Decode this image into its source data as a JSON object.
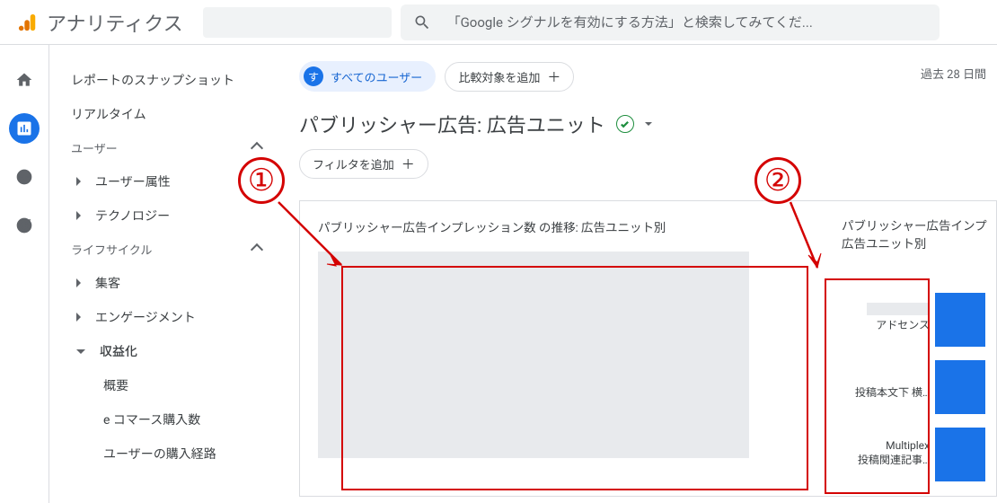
{
  "header": {
    "brand": "アナリティクス",
    "search_placeholder": "「Google シグナルを有効にする方法」と検索してみてくだ..."
  },
  "rail": {
    "icons": [
      "home",
      "reports",
      "explore",
      "advertising"
    ]
  },
  "sidebar": {
    "snapshot": "レポートのスナップショット",
    "realtime": "リアルタイム",
    "section_user": "ユーザー",
    "user_attr": "ユーザー属性",
    "technology": "テクノロジー",
    "section_lifecycle": "ライフサイクル",
    "acquisition": "集客",
    "engagement": "エンゲージメント",
    "monetization": "収益化",
    "overview": "概要",
    "ecommerce": "e コマース購入数",
    "purchase_path": "ユーザーの購入経路"
  },
  "main": {
    "segment_avatar": "す",
    "segment_label": "すべてのユーザー",
    "add_compare": "比較対象を追加",
    "date_range": "過去 28 日間",
    "title": "パブリッシャー広告: 広告ユニット",
    "add_filter": "フィルタを追加"
  },
  "card": {
    "left_title": "パブリッシャー広告インプレッション数 の推移: 広告ユニット別",
    "right_title_l1": "パブリッシャー広告インプ",
    "right_title_l2": "広告ユニット別"
  },
  "chart_data": {
    "type": "bar",
    "title": "パブリッシャー広告インプレッション 広告ユニット別",
    "categories": [
      "アドセンス",
      "投稿本文下 横…",
      "Multiplex 投稿関連記事…"
    ],
    "values": [
      null,
      null,
      null
    ],
    "note": "values redacted in source; relative bar widths appear equal (solid blue blocks)"
  },
  "bars": [
    {
      "label_top_redacted": true,
      "label": "アドセンス"
    },
    {
      "label_top_redacted": false,
      "label": "投稿本文下 横…"
    },
    {
      "label_top_redacted": false,
      "label": "Multiplex\n投稿関連記事…"
    }
  ],
  "annotations": {
    "n1": "①",
    "n2": "②"
  }
}
